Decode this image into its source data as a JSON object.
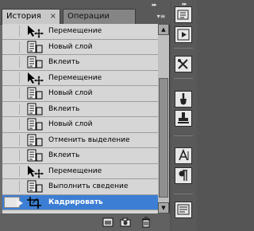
{
  "tabs": [
    {
      "label": "История",
      "active": true,
      "close_glyph": "×"
    },
    {
      "label": "Операции",
      "active": false
    }
  ],
  "panel_menu_glyph": "▾≡",
  "collapse_glyph": "▸▸",
  "history_items": [
    {
      "label": "Перемещение",
      "icon": "move-tool-icon"
    },
    {
      "label": "Новый слой",
      "icon": "history-state-icon"
    },
    {
      "label": "Вклеить",
      "icon": "history-state-icon"
    },
    {
      "label": "Перемещение",
      "icon": "move-tool-icon"
    },
    {
      "label": "Новый слой",
      "icon": "history-state-icon"
    },
    {
      "label": "Вклеить",
      "icon": "history-state-icon"
    },
    {
      "label": "Новый слой",
      "icon": "history-state-icon"
    },
    {
      "label": "Отменить выделение",
      "icon": "history-state-icon"
    },
    {
      "label": "Вклеить",
      "icon": "history-state-icon"
    },
    {
      "label": "Перемещение",
      "icon": "move-tool-icon"
    },
    {
      "label": "Выполнить сведение",
      "icon": "history-state-icon"
    },
    {
      "label": "Кадрировать",
      "icon": "crop-tool-icon",
      "selected": true
    }
  ],
  "scrollbar": {
    "up_glyph": "▲",
    "down_glyph": "▼"
  },
  "bottom_actions": [
    "new-document-from-state-icon",
    "new-snapshot-icon",
    "delete-state-icon"
  ],
  "right_toolbar": [
    "play-icon",
    "tools-icon",
    "brush-icon",
    "stamp-icon",
    "character-icon",
    "paragraph-icon",
    "notes-icon"
  ],
  "colors": {
    "selection": "#3c7ed3",
    "list_bg": "#d6d6d6",
    "panel_bg": "#6b6b6b"
  }
}
